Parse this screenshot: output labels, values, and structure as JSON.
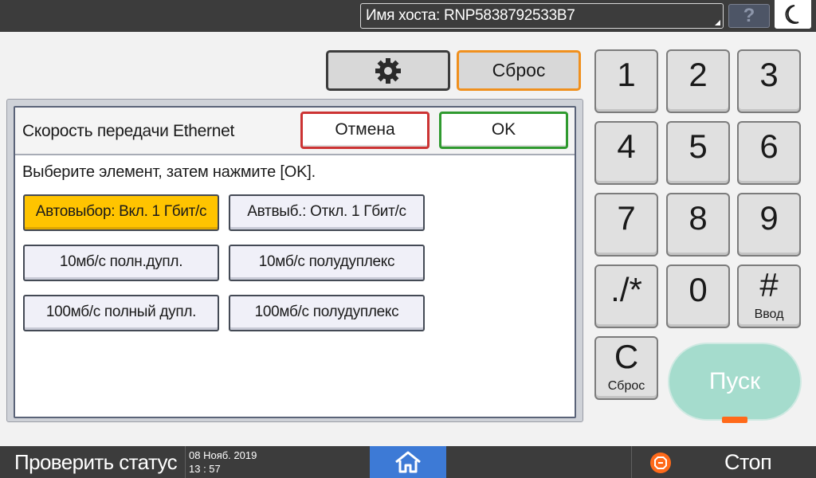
{
  "topbar": {
    "hostname": "Имя хоста: RNP5838792533B7",
    "help_label": "?",
    "energy_icon": "moon-icon"
  },
  "controls": {
    "settings_icon": "gear-icon",
    "reset_label": "Сброс"
  },
  "dialog": {
    "title": "Скорость передачи Ethernet",
    "cancel_label": "Отмена",
    "ok_label": "OK",
    "instruction": "Выберите элемент, затем нажмите [OK].",
    "options": [
      {
        "label": "Автовыбор: Вкл. 1 Гбит/с",
        "selected": true
      },
      {
        "label": "Автвыб.: Откл. 1 Гбит/с",
        "selected": false
      },
      {
        "label": "10мб/с полн.дупл.",
        "selected": false
      },
      {
        "label": "10мб/с полудуплекс",
        "selected": false
      },
      {
        "label": "100мб/с полный дупл.",
        "selected": false
      },
      {
        "label": "100мб/с полудуплекс",
        "selected": false
      }
    ]
  },
  "keypad": {
    "keys": [
      "1",
      "2",
      "3",
      "4",
      "5",
      "6",
      "7",
      "8",
      "9",
      "./*",
      "0",
      "#"
    ],
    "enter_sub": "Ввод",
    "clear_main": "C",
    "clear_sub": "Сброс",
    "start_label": "Пуск"
  },
  "bottombar": {
    "status_label": "Проверить статус",
    "date": "08 Нояб. 2019",
    "time": "13 : 57",
    "home_icon": "home-icon",
    "stop_label": "Стоп"
  },
  "colors": {
    "bar": "#3c3c3c",
    "selected": "#ffc400",
    "reset_border": "#f0901e",
    "cancel_border": "#cc3333",
    "ok_border": "#2f9a2f",
    "start": "#a5dccd",
    "home": "#3d7ad6",
    "stop": "#ff6a1a"
  }
}
